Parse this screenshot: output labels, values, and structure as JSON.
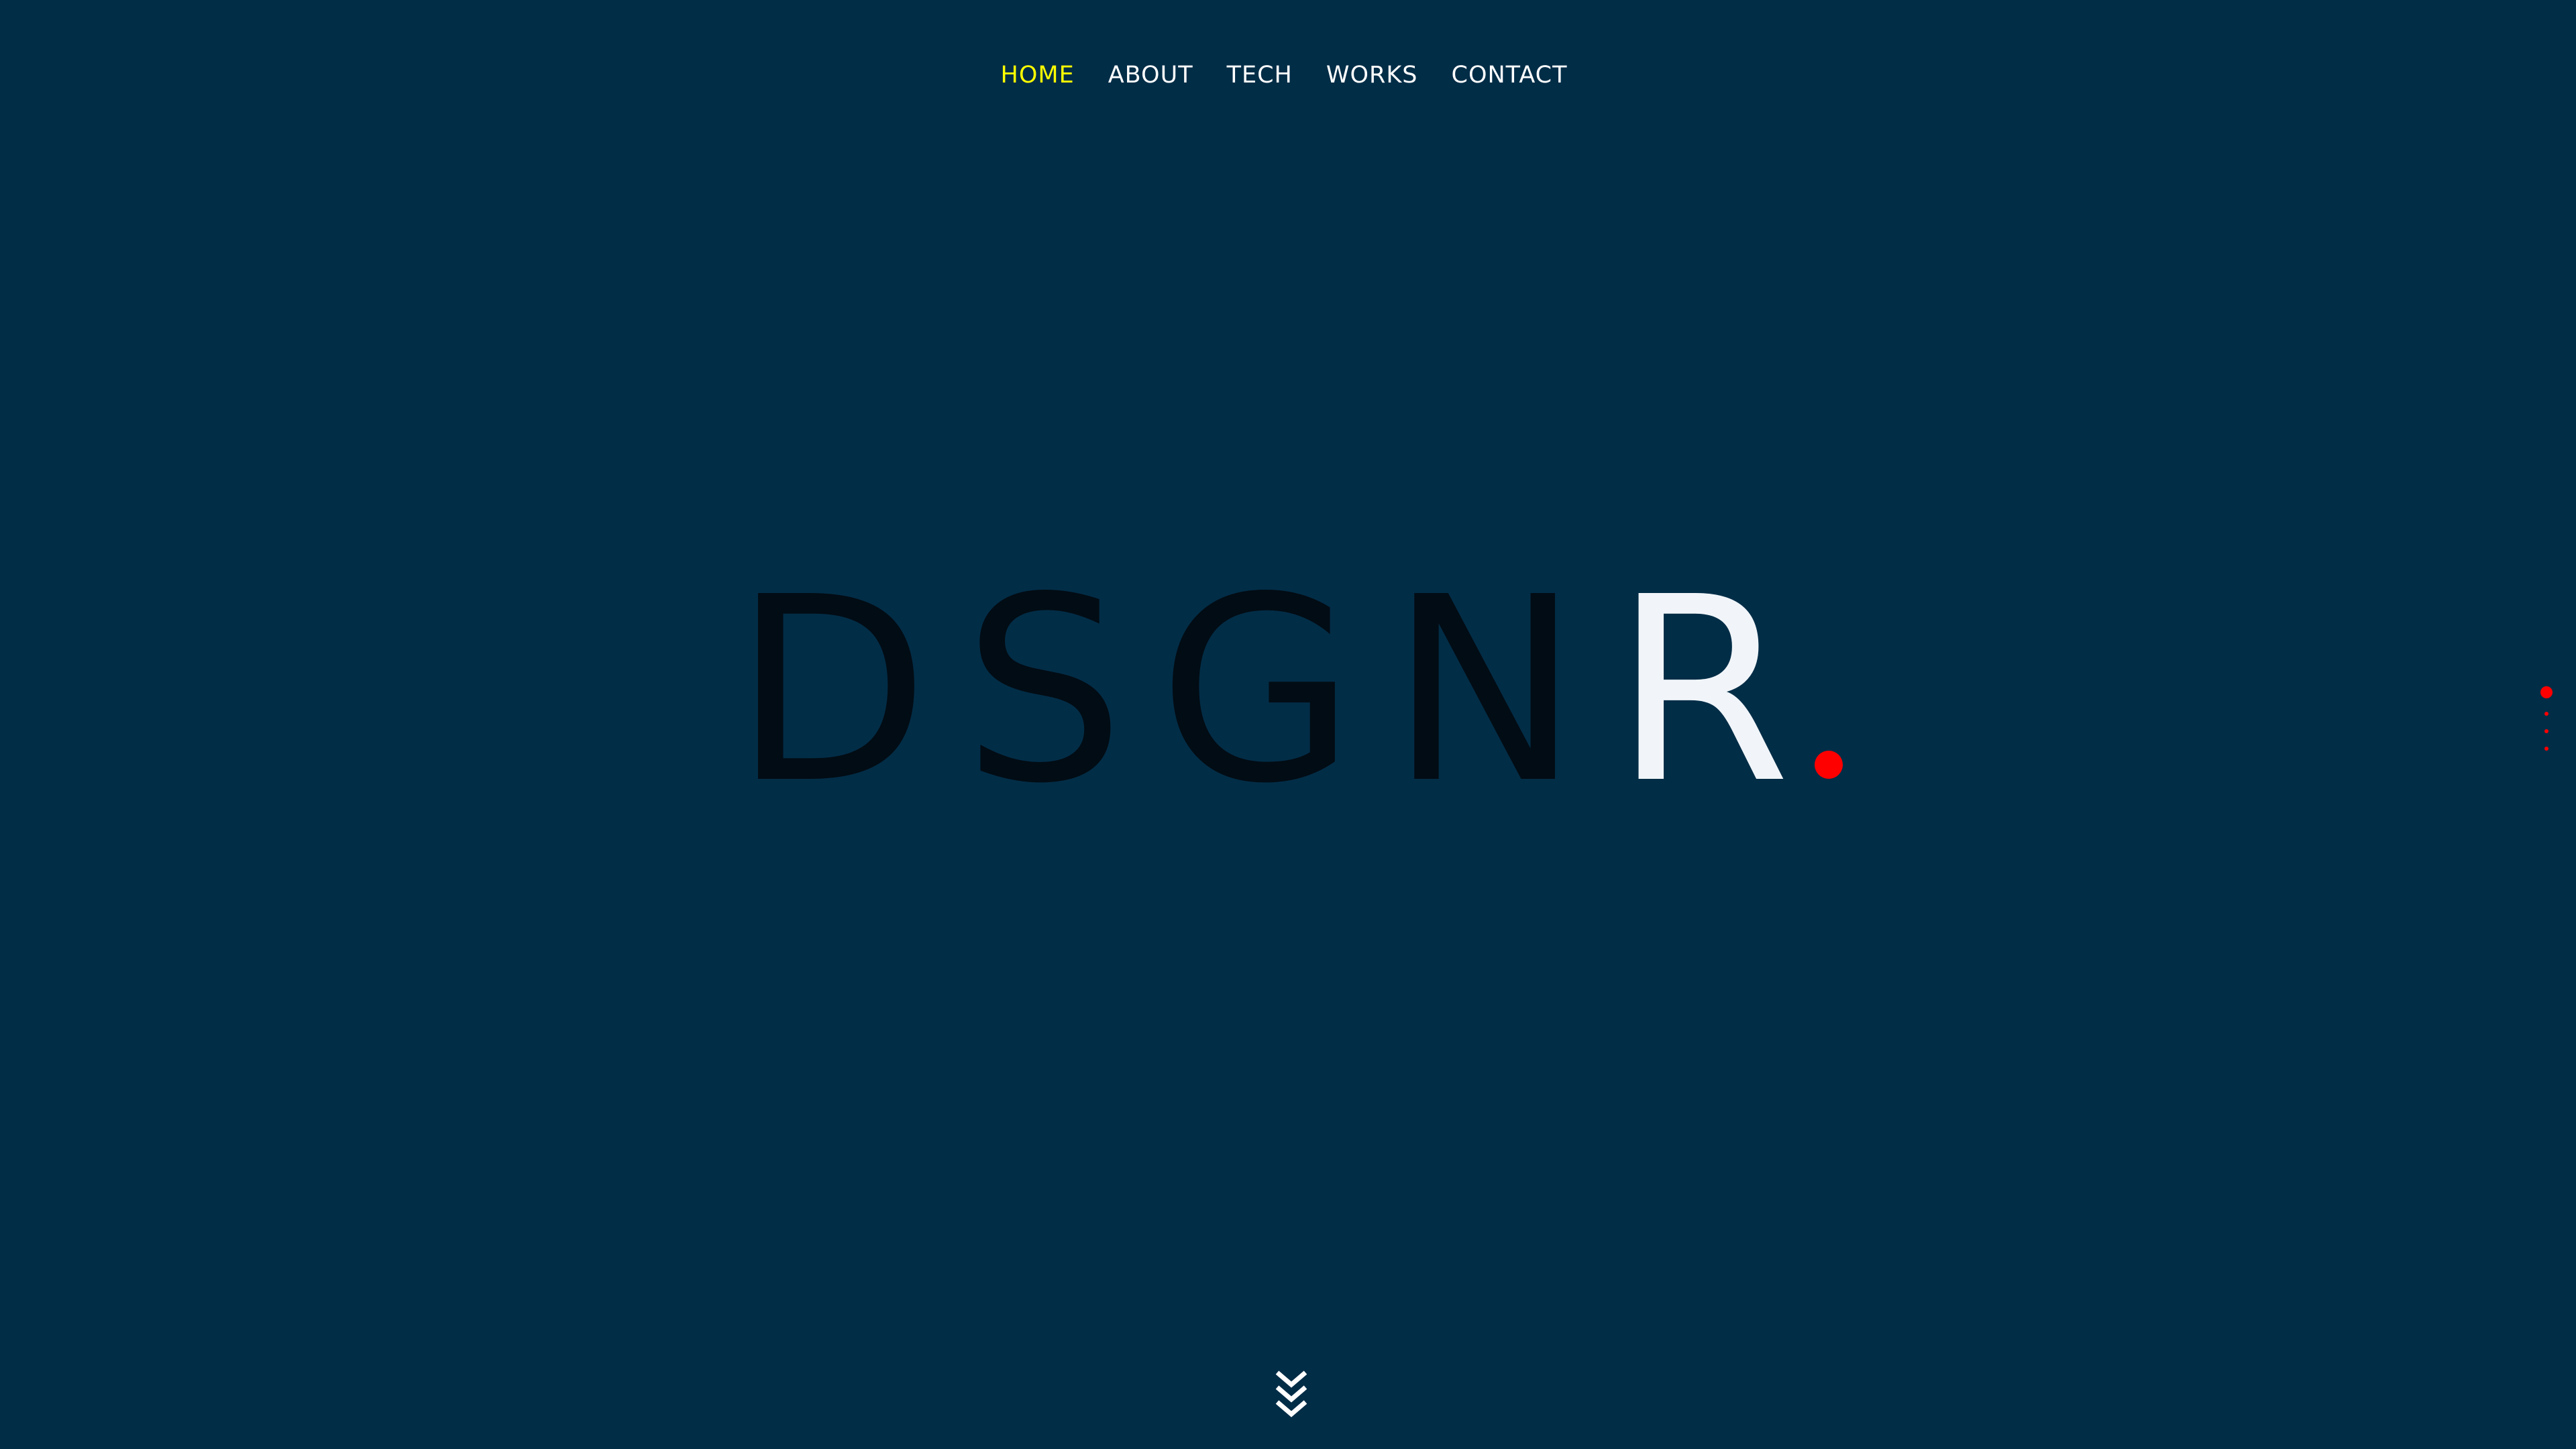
{
  "nav": {
    "items": [
      {
        "label": "HOME",
        "active": true
      },
      {
        "label": "ABOUT",
        "active": false
      },
      {
        "label": "TECH",
        "active": false
      },
      {
        "label": "WORKS",
        "active": false
      },
      {
        "label": "CONTACT",
        "active": false
      }
    ]
  },
  "hero": {
    "logo_dark": "DSGN",
    "logo_light": "R"
  },
  "pager": {
    "count": 4,
    "active_index": 0
  },
  "icons": {
    "scroll_down": "triple-chevron-down-icon",
    "logo_dot": "red-dot"
  },
  "colors": {
    "background": "#022d47",
    "active_nav": "#ffff00",
    "nav": "#ffffff",
    "logo_dark": "#020c14",
    "logo_light": "#f1f5f9",
    "accent": "#ff0000"
  }
}
